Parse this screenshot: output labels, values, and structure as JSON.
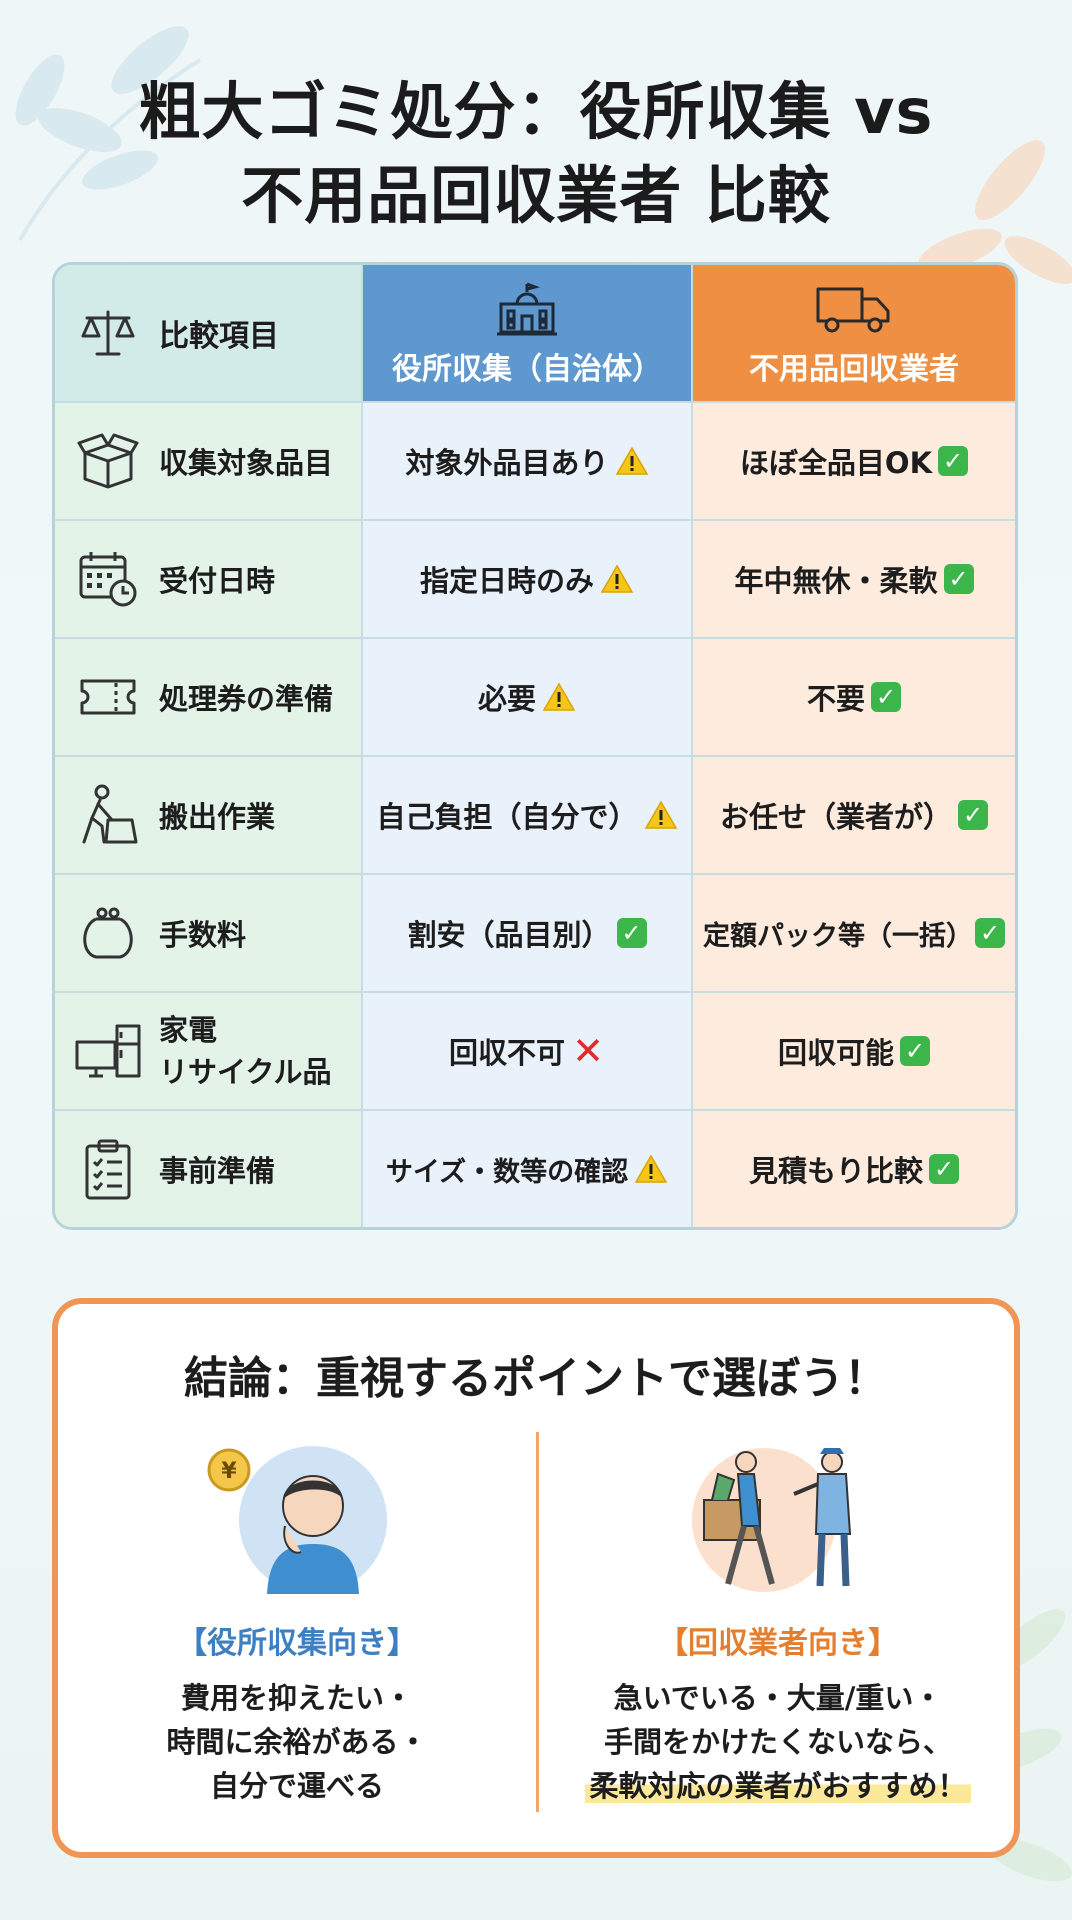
{
  "title": {
    "line1": "粗大ゴミ処分：役所収集 vs",
    "line2": "不用品回収業者 比較"
  },
  "table": {
    "header": {
      "item": "比較項目",
      "city": "役所収集（自治体）",
      "vendor": "不用品回収業者"
    },
    "rows": [
      {
        "icon": "box-icon",
        "label": "収集対象品目",
        "city": "対象外品目あり",
        "city_mark": "warning",
        "vendor": "ほぼ全品目OK",
        "vendor_mark": "check"
      },
      {
        "icon": "calendar-clock-icon",
        "label": "受付日時",
        "city": "指定日時のみ",
        "city_mark": "warning",
        "vendor": "年中無休・柔軟",
        "vendor_mark": "check"
      },
      {
        "icon": "ticket-icon",
        "label": "処理券の準備",
        "city": "必要",
        "city_mark": "warning",
        "vendor": "不要",
        "vendor_mark": "check"
      },
      {
        "icon": "person-carrying-icon",
        "label": "搬出作業",
        "city": "自己負担（自分で）",
        "city_mark": "warning",
        "vendor": "お任せ（業者が）",
        "vendor_mark": "check"
      },
      {
        "icon": "coin-purse-icon",
        "label": "手数料",
        "city": "割安（品目別）",
        "city_mark": "check",
        "vendor": "定額パック等（一括）",
        "vendor_mark": "check"
      },
      {
        "icon": "appliances-icon",
        "label_line1": "家電",
        "label_line2": "リサイクル品",
        "city": "回収不可",
        "city_mark": "cross",
        "vendor": "回収可能",
        "vendor_mark": "check"
      },
      {
        "icon": "clipboard-checklist-icon",
        "label": "事前準備",
        "city": "サイズ・数等の確認",
        "city_mark": "warning",
        "vendor": "見積もり比較",
        "vendor_mark": "check"
      }
    ]
  },
  "conclusion": {
    "title": "結論：重視するポイントで選ぼう！",
    "left": {
      "heading": "【役所収集向き】",
      "lines": [
        "費用を抑えたい・",
        "時間に余裕がある・",
        "自分で運べる"
      ]
    },
    "right": {
      "heading": "【回収業者向き】",
      "lines": [
        "急いでいる・大量/重い・",
        "手間をかけたくないなら、",
        "柔軟対応の業者がおすすめ！"
      ]
    }
  },
  "colors": {
    "city_header": "#5f97cf",
    "vendor_header": "#ef8f43",
    "check": "#3cb54a",
    "warning": "#f5c518",
    "cross": "#e02b2b"
  }
}
